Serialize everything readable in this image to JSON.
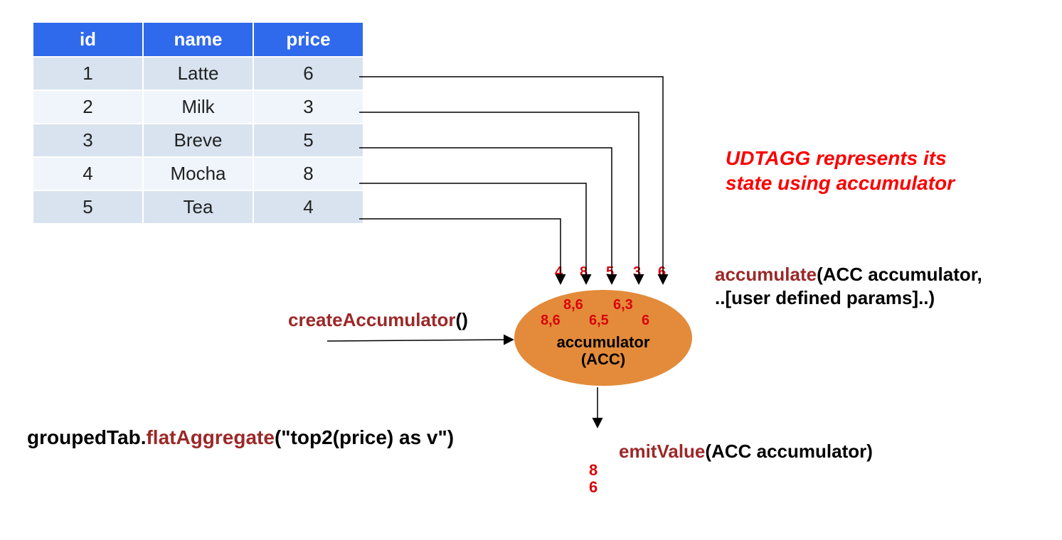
{
  "table": {
    "headers": {
      "id": "id",
      "name": "name",
      "price": "price"
    },
    "rows": [
      {
        "id": "1",
        "name": "Latte",
        "price": "6"
      },
      {
        "id": "2",
        "name": "Milk",
        "price": "3"
      },
      {
        "id": "3",
        "name": "Breve",
        "price": "5"
      },
      {
        "id": "4",
        "name": "Mocha",
        "price": "8"
      },
      {
        "id": "5",
        "name": "Tea",
        "price": "4"
      }
    ]
  },
  "caption": {
    "line1": "UDTAGG represents its",
    "line2": "state using accumulator"
  },
  "labels": {
    "createAccumulator": "createAccumulator",
    "createParen": "()",
    "accumulateFn": "accumulate",
    "accumulateArgs1": "(ACC accumulator,",
    "accumulateArgs2": "..[user defined params]..)",
    "emitFn": "emitValue",
    "emitArgs": "(ACC accumulator)",
    "aggPrefix": "groupedTab.",
    "aggFn": "flatAggregate",
    "aggArgs": "(\"top2(price) as v\")",
    "accTitle": "accumulator",
    "accSub": "(ACC)"
  },
  "flow": {
    "topIncoming": [
      "4",
      "8",
      "5",
      "3",
      "6"
    ],
    "stateA": [
      "8,6",
      "6,3"
    ],
    "stateB": [
      "8,6",
      "6,5",
      "6"
    ],
    "emitted": [
      "8",
      "6"
    ]
  }
}
